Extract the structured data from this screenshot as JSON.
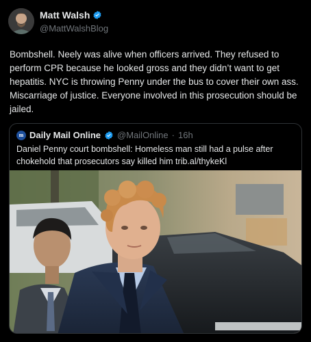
{
  "author": {
    "name": "Matt Walsh",
    "handle": "@MattWalshBlog"
  },
  "tweet": {
    "text": "Bombshell. Neely was alive when officers arrived. They refused to perform CPR because he looked gross and they didn’t want to get hepatitis. NYC is throwing Penny under the bus to cover their own ass. Miscarriage of justice. Everyone involved in this prosecution should be jailed."
  },
  "quoted": {
    "name": "Daily Mail Online",
    "handle": "@MailOnline",
    "separator": "·",
    "time": "16h",
    "logo_glyph": "m",
    "text": "Daniel Penny court bombshell: Homeless man still had a pulse after chokehold that prosecutors say killed him trib.al/thykeKl"
  },
  "colors": {
    "background": "#000000",
    "text": "#e7e9ea",
    "muted": "#71767b",
    "verified": "#1d9bf0",
    "border": "#2f3336"
  },
  "icons": {
    "verified": "verified-badge-icon",
    "publisher": "daily-mail-logo-icon"
  }
}
